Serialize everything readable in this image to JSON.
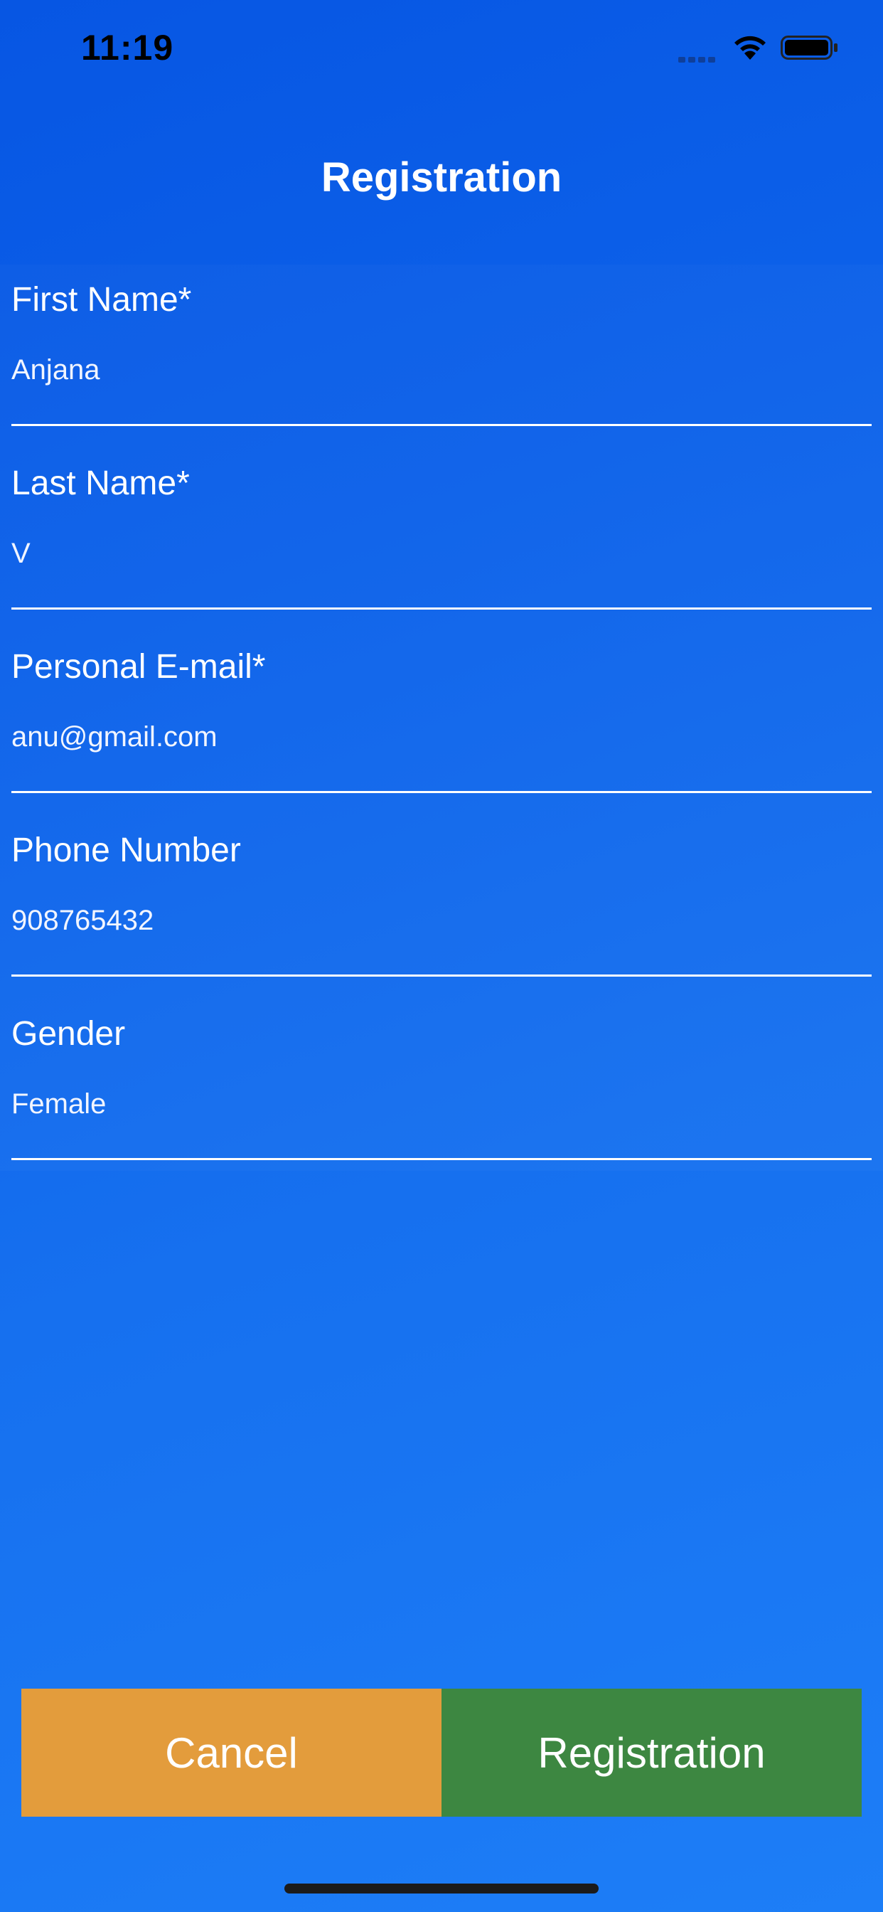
{
  "status_bar": {
    "time": "11:19",
    "icons": [
      "cellular-signal-icon",
      "wifi-icon",
      "battery-icon"
    ]
  },
  "nav": {
    "title": "Registration"
  },
  "form": {
    "fields": [
      {
        "label": "First Name*",
        "value": "Anjana"
      },
      {
        "label": "Last Name*",
        "value": "V"
      },
      {
        "label": "Personal E-mail*",
        "value": "anu@gmail.com"
      },
      {
        "label": "Phone Number",
        "value": "908765432"
      },
      {
        "label": "Gender",
        "value": "Female"
      }
    ]
  },
  "buttons": {
    "cancel_label": "Cancel",
    "register_label": "Registration"
  },
  "colors": {
    "background_top": "#0756e3",
    "background_bottom": "#1d7ef7",
    "cancel_button": "#e39c3c",
    "register_button": "#3d8741"
  }
}
